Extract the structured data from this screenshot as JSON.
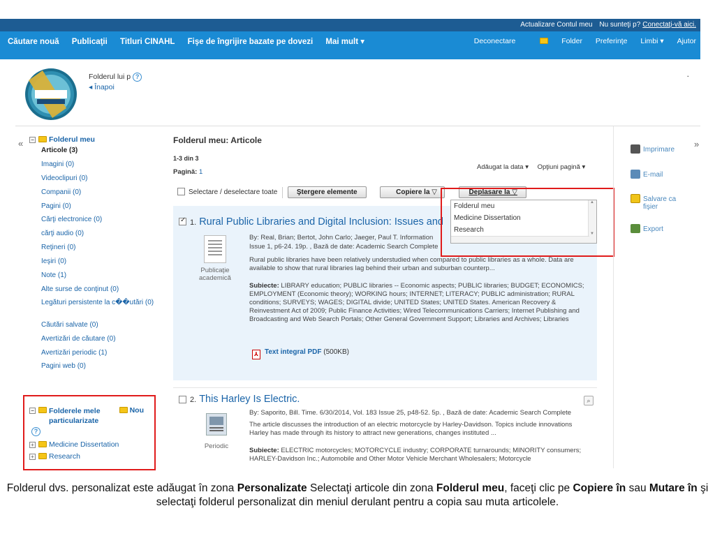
{
  "topbar": {
    "update_account": "Actualizare Contul meu",
    "not_user": "Nu sunteţi p?",
    "login_link": "Conectaţi-vă aici."
  },
  "nav": {
    "items": [
      "Căutare nouă",
      "Publicaţii",
      "Titluri CINAHL",
      "Fişe de îngrijire bazate pe dovezi",
      "Mai mult ▾"
    ],
    "right": {
      "logout": "Deconectare",
      "folder": "Folder",
      "preferences": "Preferinţe",
      "languages": "Limbi ▾",
      "help": "Ajutor"
    }
  },
  "header": {
    "folder_owner": "Folderul lui p",
    "back": "◂ Înapoi",
    "help_mark": "?",
    "dot": "."
  },
  "sidebar": {
    "collapse": "«",
    "title": "Folderul meu",
    "items": [
      {
        "label": "Articole (3)",
        "active": true
      },
      {
        "label": "Imagini (0)"
      },
      {
        "label": "Videoclipuri (0)"
      },
      {
        "label": "Companii (0)"
      },
      {
        "label": "Pagini (0)"
      },
      {
        "label": "Cărţi electronice (0)"
      },
      {
        "label": "cărţi audio (0)"
      },
      {
        "label": "Reţineri (0)"
      },
      {
        "label": "Ieşiri (0)"
      },
      {
        "label": "Note (1)"
      },
      {
        "label": "Alte surse de conţinut (0)"
      },
      {
        "label": "Legături persistente la c��utări (0)"
      },
      {
        "label": "Căutări salvate (0)"
      },
      {
        "label": "Avertizări de căutare (0)"
      },
      {
        "label": "Avertizări periodic (1)"
      },
      {
        "label": "Pagini web (0)"
      }
    ]
  },
  "custom_folders": {
    "title": "Folderele mele particularizate",
    "new": "Nou",
    "help_mark": "?",
    "folders": [
      "Medicine Dissertation",
      "Research"
    ]
  },
  "main": {
    "title": "Folderul meu: Articole",
    "count": "1-3 din 3",
    "page_label": "Pagină:",
    "page_value": "1",
    "sort": "Adăugat la data ▾",
    "page_options": "Opţiuni pagină ▾",
    "select_all": "Selectare / deselectare toate",
    "delete_btn": "Ştergere elemente",
    "copy_btn": "Copiere la ▽",
    "move_btn": "Deplasare la ▽",
    "move_menu": [
      "Folderul meu",
      "Medicine Dissertation",
      "Research"
    ]
  },
  "results": [
    {
      "num": "1.",
      "title": "Rural Public Libraries and Digital Inclusion: Issues and",
      "type": "Publicaţie academică",
      "citation_line1": "By: Real, Brian; Bertot, John Carlo; Jaeger, Paul T. Information",
      "citation_line2": "Issue 1, p6-24. 19p. , Bază de date: Academic Search Complete",
      "abstract": "Rural public libraries have been relatively understudied when compared to public libraries as a whole. Data are available to show that rural libraries lag behind their urban and suburban counterp...",
      "subjects_label": "Subiecte:",
      "subjects": "LIBRARY education; PUBLIC libraries -- Economic aspects; PUBLIC libraries; BUDGET; ECONOMICS; EMPLOYMENT (Economic theory); WORKING hours; INTERNET; LITERACY; PUBLIC administration; RURAL conditions; SURVEYS; WAGES; DIGITAL divide; UNITED States; UNITED States. American Recovery & Reinvestment Act of 2009; Public Finance Activities; Wired Telecommunications Carriers; Internet Publishing and Broadcasting and Web Search Portals; Other General Government Support; Libraries and Archives; Libraries",
      "pdf_label": "Text integral PDF",
      "pdf_size": "(500KB)"
    },
    {
      "num": "2.",
      "title": "This Harley Is Electric.",
      "type": "Periodic",
      "citation": "By: Saporito, Bill. Time. 6/30/2014, Vol. 183 Issue 25, p48-52. 5p. , Bază de date: Academic Search Complete",
      "abstract": "The article discusses the introduction of an electric motorcycle by Harley-Davidson. Topics include innovations Harley has made through its history to attract new generations, changes instituted ...",
      "subjects_label": "Subiecte:",
      "subjects": "ELECTRIC motorcycles; MOTORCYCLE industry; CORPORATE turnarounds; MINORITY consumers; HARLEY-Davidson Inc.; Automobile and Other Motor Vehicle Merchant Wholesalers; Motorcycle"
    }
  ],
  "tools": {
    "collapse": "»",
    "print": "Imprimare",
    "email": "E-mail",
    "save_line1": "Salvare ca",
    "save_line2": "fişier",
    "export": "Export"
  },
  "caption": {
    "p1": "Folderul dvs. personalizat este adăugat în zona ",
    "b1": "Personalizate",
    "p2": " Selectaţi articole din zona ",
    "b2": "Folderul meu",
    "p3": ", faceţi clic pe ",
    "b3": "Copiere în",
    "p4": " sau ",
    "b4": "Mutare în",
    "p5": " şi selectaţi folderul personalizat din meniul derulant pentru a copia sau muta articolele."
  }
}
